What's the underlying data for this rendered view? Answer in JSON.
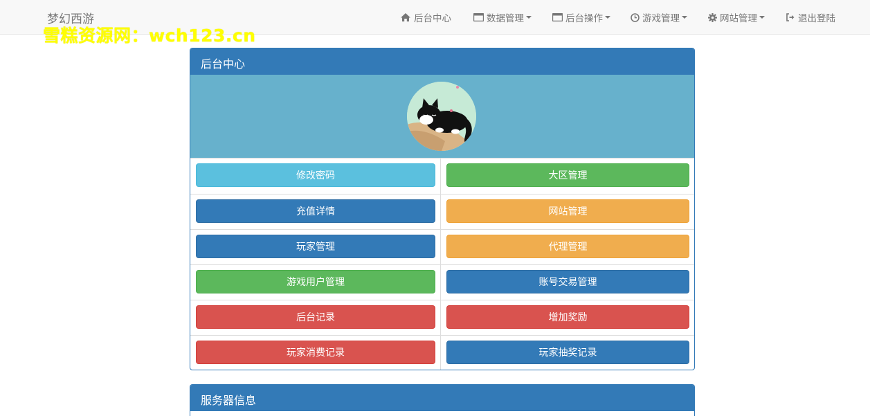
{
  "navbar": {
    "brand": "梦幻西游",
    "watermark": "雪糕资源网：wch123.cn",
    "items": [
      {
        "label": "后台中心",
        "icon": "home-icon",
        "dropdown": false
      },
      {
        "label": "数据管理",
        "icon": "window-icon",
        "dropdown": true
      },
      {
        "label": "后台操作",
        "icon": "window-icon",
        "dropdown": true
      },
      {
        "label": "游戏管理",
        "icon": "clock-icon",
        "dropdown": true
      },
      {
        "label": "网站管理",
        "icon": "gear-icon",
        "dropdown": true
      },
      {
        "label": "退出登陆",
        "icon": "logout-icon",
        "dropdown": false
      }
    ]
  },
  "admin_panel": {
    "title": "后台中心",
    "buttons": [
      {
        "label": "修改密码",
        "style": "info"
      },
      {
        "label": "大区管理",
        "style": "success"
      },
      {
        "label": "充值详情",
        "style": "primary"
      },
      {
        "label": "网站管理",
        "style": "warning"
      },
      {
        "label": "玩家管理",
        "style": "primary"
      },
      {
        "label": "代理管理",
        "style": "warning"
      },
      {
        "label": "游戏用户管理",
        "style": "success"
      },
      {
        "label": "账号交易管理",
        "style": "primary"
      },
      {
        "label": "后台记录",
        "style": "danger"
      },
      {
        "label": "增加奖励",
        "style": "danger"
      },
      {
        "label": "玩家消费记录",
        "style": "danger"
      },
      {
        "label": "玩家抽奖记录",
        "style": "primary"
      }
    ]
  },
  "server_panel": {
    "title": "服务器信息"
  },
  "colors": {
    "primary": "#337ab7",
    "info": "#5bc0de",
    "success": "#5cb85c",
    "warning": "#f0ad4e",
    "danger": "#d9534f",
    "hero_bg": "#67b1cc",
    "watermark": "#ffff00"
  }
}
